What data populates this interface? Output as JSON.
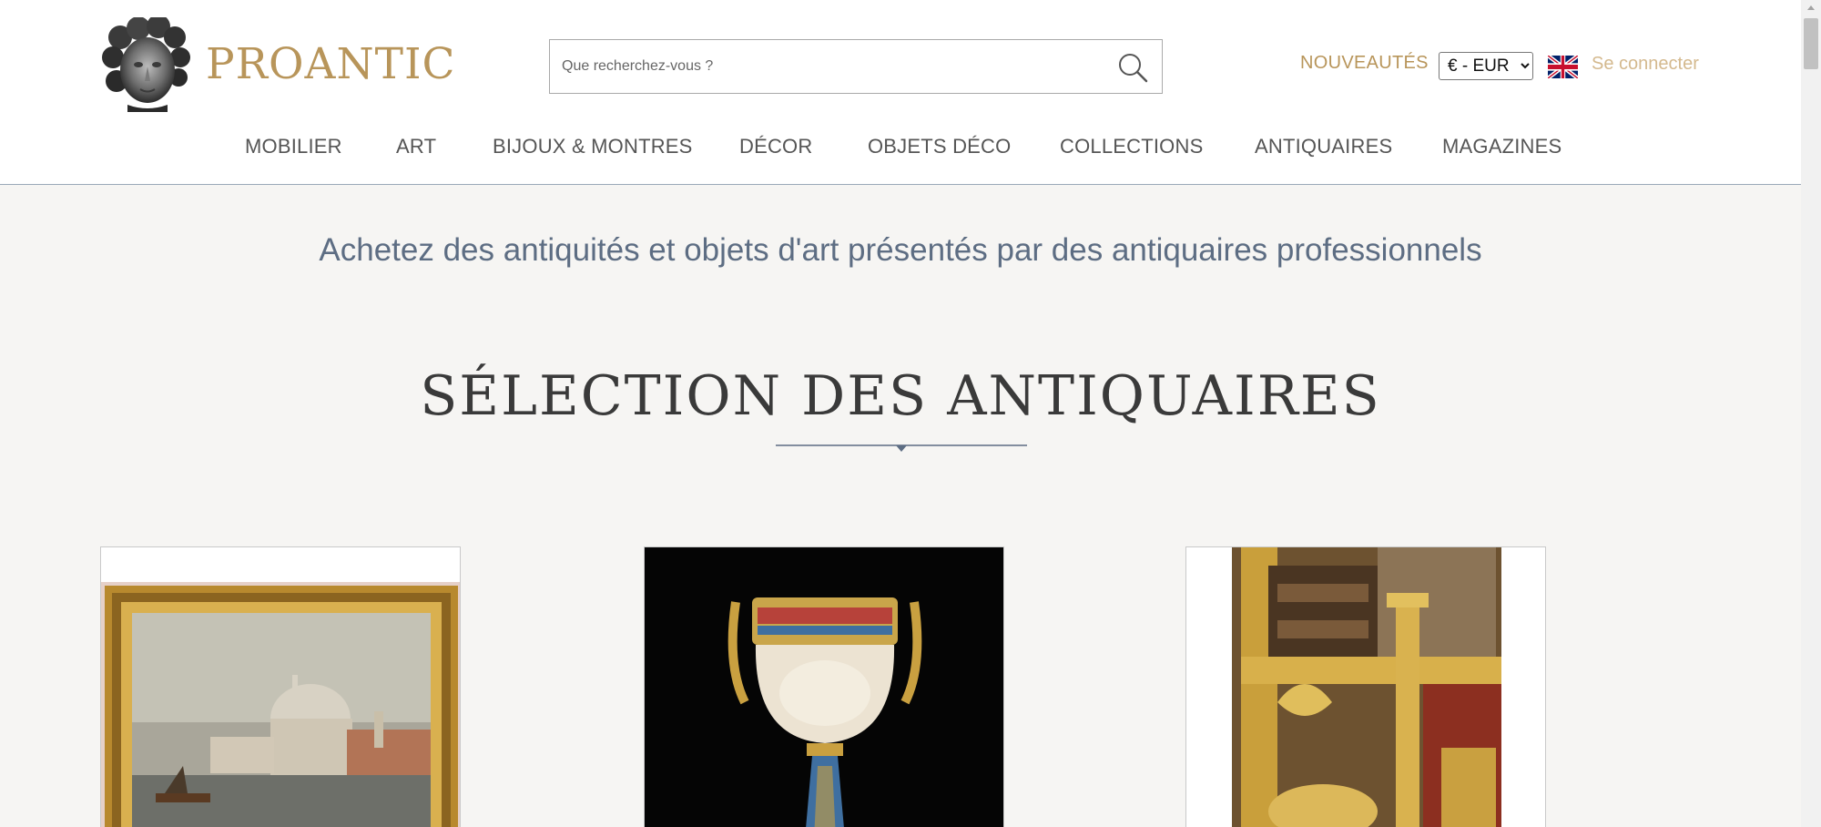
{
  "header": {
    "logo_text": "PROANTIC",
    "search_placeholder": "Que recherchez-vous ?",
    "nouveautes_label": "NOUVEAUTÉS",
    "currency": {
      "selected": "€ - EUR",
      "options": [
        "€ - EUR"
      ]
    },
    "language_flag": "uk-flag-icon",
    "login_label": "Se connecter"
  },
  "nav": {
    "items": [
      {
        "label": "MOBILIER"
      },
      {
        "label": "ART"
      },
      {
        "label": "BIJOUX & MONTRES"
      },
      {
        "label": "DÉCOR"
      },
      {
        "label": "OBJETS DÉCO"
      },
      {
        "label": "COLLECTIONS"
      },
      {
        "label": "ANTIQUAIRES"
      },
      {
        "label": "MAGAZINES"
      }
    ]
  },
  "main": {
    "tagline": "Achetez des antiquités et objets d'art présentés par des antiquaires professionnels",
    "section_title": "SÉLECTION DES ANTIQUAIRES",
    "cards": [
      {
        "image": "venice-painting-gilt-frame"
      },
      {
        "image": "onyx-enamel-gilt-vase"
      },
      {
        "image": "gilt-bronze-candlestick"
      }
    ]
  },
  "colors": {
    "brand_gold": "#b8955a",
    "login_gold": "#d4b98e",
    "tagline_blue": "#5d6d83",
    "page_bg": "#f6f5f3"
  }
}
